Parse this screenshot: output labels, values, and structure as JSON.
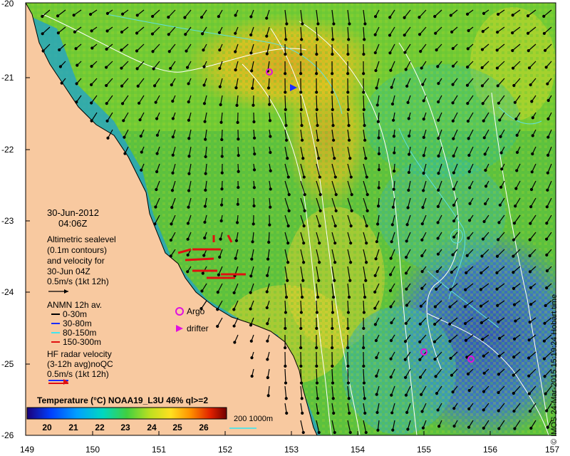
{
  "map": {
    "yticks": [
      "-20",
      "-21",
      "-22",
      "-23",
      "-24",
      "-25",
      "-26"
    ],
    "xticks": [
      "149",
      "150",
      "151",
      "152",
      "153",
      "154",
      "155",
      "156",
      "157"
    ],
    "date": "30-Jun-2012",
    "time": "04:06Z",
    "altimetry": [
      "Altimetric sealevel",
      "(0.1m contours)",
      "and velocity for",
      "30-Jun 04Z",
      "0.5m/s (1kt 12h)"
    ],
    "anmn_title": "ANMN 12h av.",
    "anmn_items": [
      {
        "label": "0-30m",
        "color": "#000000"
      },
      {
        "label": "30-80m",
        "color": "#1a2cff"
      },
      {
        "label": "80-150m",
        "color": "#3ee6f0"
      },
      {
        "label": "150-300m",
        "color": "#e01010"
      }
    ],
    "argo_label": "Argo",
    "drifter_label": "drifter",
    "hf_radar": [
      "HF radar velocity",
      "(3-12h avg)noQC",
      "0.5m/s (1kt 12h)"
    ],
    "colorbar_title": "Temperature (°C) NOAA19_L3U 46% ql>=2",
    "colorbar_ticks": [
      "20",
      "21",
      "22",
      "23",
      "24",
      "25",
      "26"
    ],
    "depth_label": "200  1000m",
    "credit": "© IMOS 24-Mar-2015 15:19:24 Hobart time",
    "colors": {
      "land": "#f8c9a0",
      "argo": "#e010e0",
      "drifter": "#e010e0",
      "contour": "#ffffff",
      "depth": "#60e0e0"
    }
  }
}
